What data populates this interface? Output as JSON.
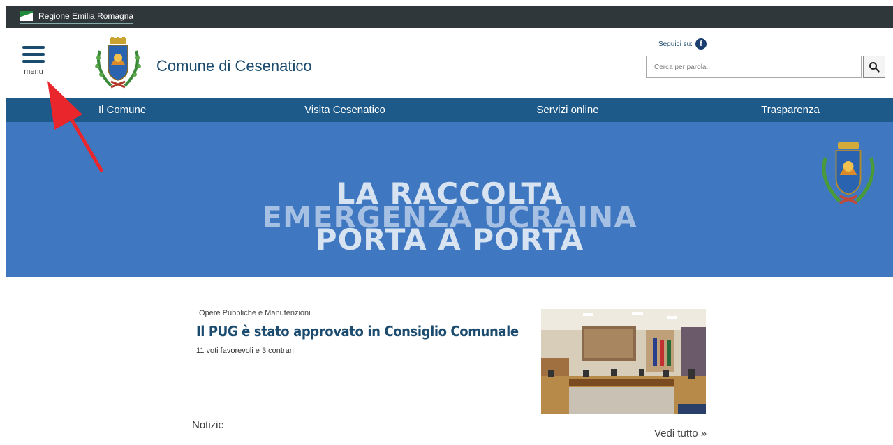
{
  "region_bar": {
    "label": "Regione Emilia Romagna"
  },
  "header": {
    "menu_label": "menu",
    "site_title": "Comune di Cesenatico",
    "follow_label": "Seguici su:",
    "follow_icon": "facebook-icon",
    "search_placeholder": "Cerca per parola...",
    "search_icon": "search-icon"
  },
  "nav": {
    "items": [
      {
        "label": "Il Comune"
      },
      {
        "label": "Visita Cesenatico"
      },
      {
        "label": "Servizi online"
      },
      {
        "label": "Trasparenza"
      }
    ]
  },
  "banner": {
    "line1": "LA RACCOLTA",
    "line2": "EMERGENZA UCRAINA",
    "line3": "PORTA A PORTA"
  },
  "news": {
    "category": "Opere Pubbliche e Manutenzioni",
    "title": "Il PUG è stato approvato in Consiglio Comunale",
    "subtitle": "11 voti favorevoli e 3 contrari"
  },
  "section": {
    "title": "Notizie",
    "see_all": "Vedi tutto »"
  },
  "colors": {
    "brand": "#1b4b6e",
    "nav_bg": "#1d5a8a",
    "banner_bg": "#3f78c1",
    "region_bar": "#30373b",
    "annotation_arrow": "#e8262b"
  }
}
